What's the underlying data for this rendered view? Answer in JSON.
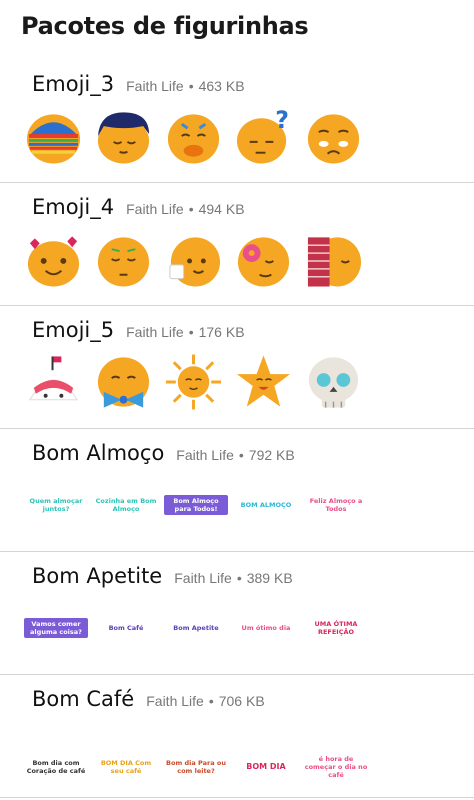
{
  "title": "Pacotes de figurinhas",
  "packs": [
    {
      "name": "Emoji_3",
      "author": "Faith Life",
      "size": "463 KB",
      "sep": "•"
    },
    {
      "name": "Emoji_4",
      "author": "Faith Life",
      "size": "494 KB",
      "sep": "•"
    },
    {
      "name": "Emoji_5",
      "author": "Faith Life",
      "size": "176 KB",
      "sep": "•"
    },
    {
      "name": "Bom Almoço",
      "author": "Faith Life",
      "size": "792 KB",
      "sep": "•"
    },
    {
      "name": "Bom Apetite",
      "author": "Faith Life",
      "size": "389 KB",
      "sep": "•"
    },
    {
      "name": "Bom Café",
      "author": "Faith Life",
      "size": "706 KB",
      "sep": "•"
    }
  ],
  "text_stickers": {
    "almoco": [
      "Quem almoçar juntos?",
      "Cozinha em Bom Almoço",
      "Bom Almoço para Todos!",
      "BOM ALMOÇO",
      "Feliz Almoço a Todos"
    ],
    "apetite": [
      "Vamos comer alguma coisa?",
      "Bom Café",
      "Bom Apetite",
      "Um ótimo dia",
      "UMA ÓTIMA REFEIÇÃO"
    ],
    "cafe": [
      "Bom dia com Coração de café",
      "BOM DIA Com seu café",
      "Bom dia Para ou com leite?",
      "BOM DIA",
      "é hora de começar o dia no café"
    ]
  },
  "colors": {
    "emoji_orange": "#f5a623",
    "emoji_shade": "#e58a0f",
    "divider": "#d5d5d5",
    "meta_gray": "#777777"
  }
}
